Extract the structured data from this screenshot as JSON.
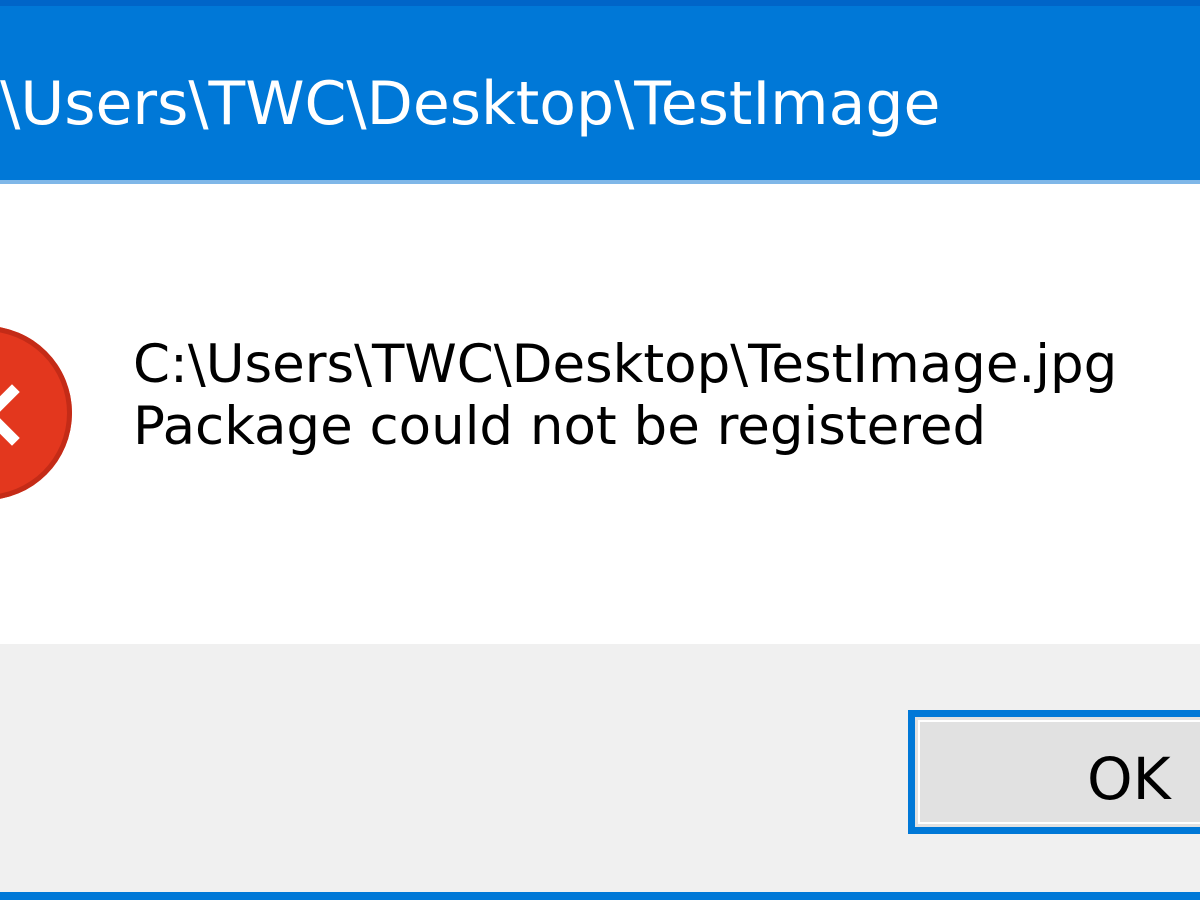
{
  "window": {
    "title": "C:\\Users\\TWC\\Desktop\\TestImage"
  },
  "message": {
    "path": "C:\\Users\\TWC\\Desktop\\TestImage.jpg",
    "error": "Package could not be registered"
  },
  "icon": {
    "name": "error-icon",
    "color": "#e3371e"
  },
  "buttons": {
    "ok_label": "OK"
  },
  "colors": {
    "accent": "#0078d7",
    "dialog_background": "#ffffff",
    "footer_background": "#f0f0f0"
  }
}
